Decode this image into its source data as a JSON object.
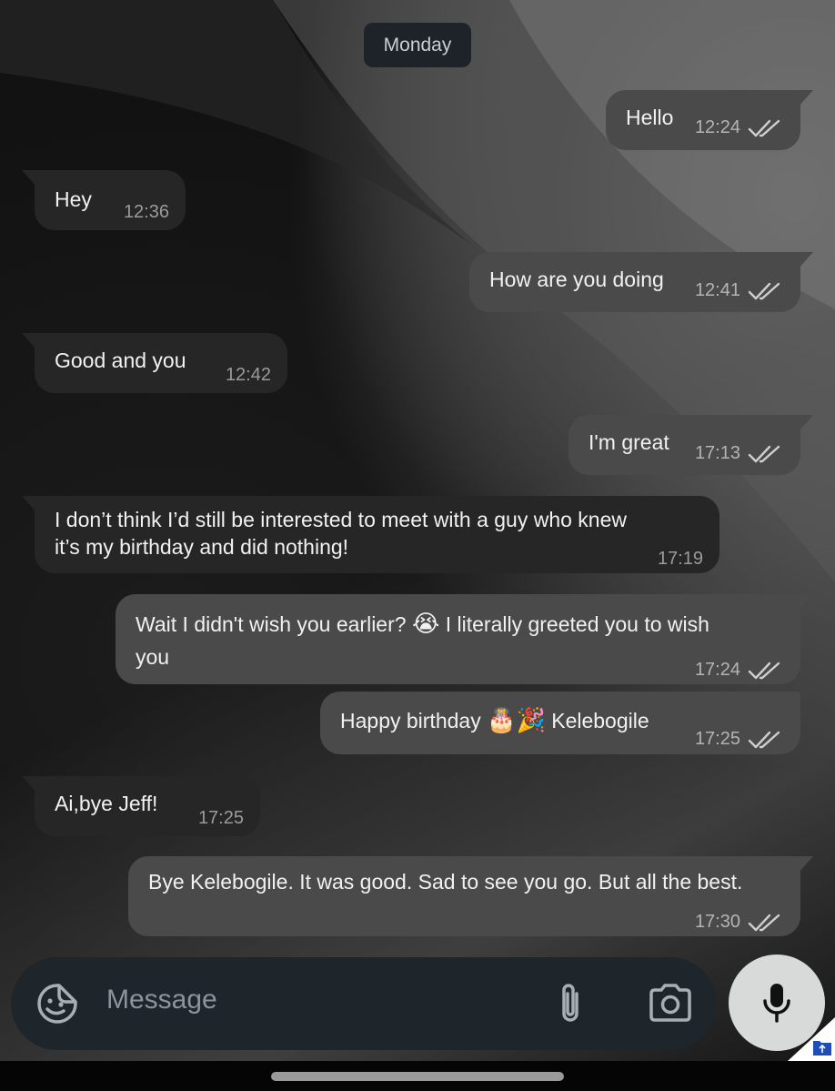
{
  "date_chip": "Monday",
  "messages": [
    {
      "dir": "out",
      "text": "Hello",
      "time": "12:24"
    },
    {
      "dir": "in",
      "text": "Hey",
      "time": "12:36"
    },
    {
      "dir": "out",
      "text": "How are you doing",
      "time": "12:41"
    },
    {
      "dir": "in",
      "text": "Good and you",
      "time": "12:42"
    },
    {
      "dir": "out",
      "text": "I'm great",
      "time": "17:13"
    },
    {
      "dir": "in",
      "line1": "I don’t think I’d still be interested to meet with a guy who knew",
      "line2": "it’s my birthday and did nothing!",
      "time": "17:19"
    },
    {
      "dir": "out",
      "part1": "Wait I didn't wish you earlier?",
      "emoji": "😭",
      "part2": "I literally greeted you to wish",
      "line2": "you",
      "time": "17:24"
    },
    {
      "dir": "out",
      "part1": "Happy birthday",
      "emoji1": "🎂",
      "emoji2": "🎉",
      "part2": "Kelebogile",
      "time": "17:25"
    },
    {
      "dir": "in",
      "text": "Ai,bye Jeff!",
      "time": "17:25"
    },
    {
      "dir": "out",
      "text": "Bye Kelebogile. It was good. Sad to see you go. But all the best.",
      "time": "17:30"
    }
  ],
  "composer": {
    "placeholder": "Message",
    "icons": [
      "sticker-icon",
      "paperclip-icon",
      "camera-icon",
      "microphone-icon"
    ]
  },
  "colors": {
    "outgoing_bubble": "#4a4a4a",
    "incoming_bubble": "#262626",
    "composer_bg": "#1e252b",
    "mic_button": "#d8d9d9"
  }
}
